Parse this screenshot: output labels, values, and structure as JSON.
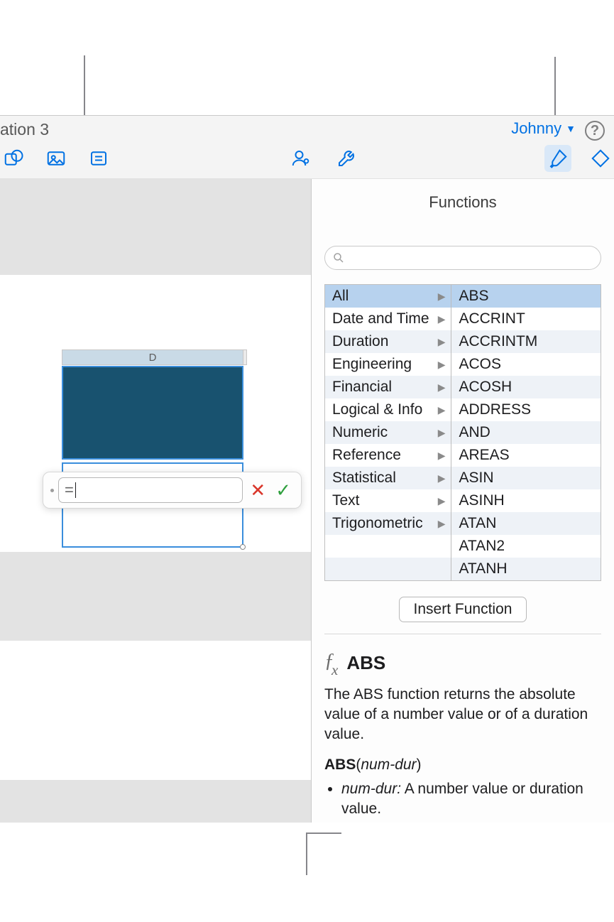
{
  "titlebar": {
    "doc_title": "ation 3",
    "user": "Johnny",
    "help_glyph": "?"
  },
  "toolbar": {
    "shape_icon": "shape",
    "media_icon": "media",
    "notes_icon": "notes",
    "collaborate_icon": "collaborate",
    "tools_icon": "tools",
    "format_icon": "format",
    "animate_icon": "animate"
  },
  "sheet": {
    "column_header": "D"
  },
  "formula_editor": {
    "prefix": "=",
    "value": ""
  },
  "sidebar": {
    "title": "Functions",
    "search_placeholder": "",
    "categories": [
      "All",
      "Date and Time",
      "Duration",
      "Engineering",
      "Financial",
      "Logical & Info",
      "Numeric",
      "Reference",
      "Statistical",
      "Text",
      "Trigonometric"
    ],
    "selected_category_index": 0,
    "functions": [
      "ABS",
      "ACCRINT",
      "ACCRINTM",
      "ACOS",
      "ACOSH",
      "ADDRESS",
      "AND",
      "AREAS",
      "ASIN",
      "ASINH",
      "ATAN",
      "ATAN2",
      "ATANH"
    ],
    "selected_function_index": 0,
    "insert_button": "Insert Function",
    "detail": {
      "fx_glyph": "ƒx",
      "name": "ABS",
      "description": "The ABS function returns the absolute value of a number value or of a duration value.",
      "signature_bold": "ABS",
      "signature_args": "num-dur",
      "arg_name": "num-dur:",
      "arg_desc": " A number value or duration value."
    }
  }
}
